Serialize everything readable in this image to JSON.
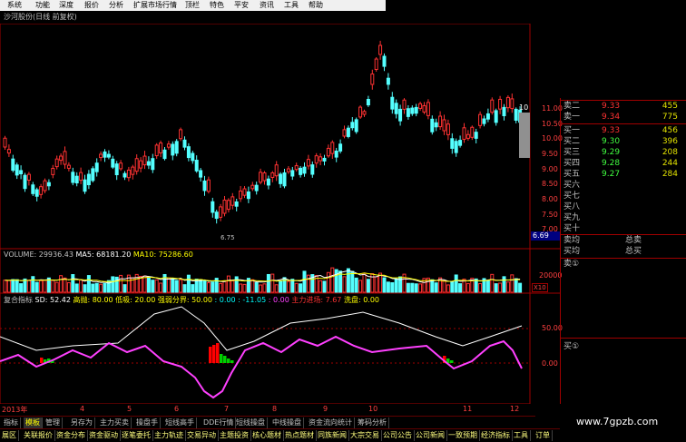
{
  "menu": [
    "系统",
    "功能",
    "深度",
    "报价",
    "分析",
    "扩展市场行情",
    "资讯",
    "工具",
    "帮助"
  ],
  "menu_hidden": [
    "顶栏",
    "特色",
    "平安"
  ],
  "window_title": "沙河股份(日线 前复权)",
  "price_axis": [
    "11.00",
    "10.50",
    "10.00",
    "9.50",
    "9.00",
    "8.50",
    "8.00",
    "7.50",
    "7.00"
  ],
  "last_price_tag": "6.69",
  "price_tag_top": "10",
  "low_marker": "6.75",
  "volume_line": {
    "label": "VOLUME: 29936.43",
    "ma5": "MA5: 68181.20",
    "ma10": "MA10: 75286.60"
  },
  "volume_axis": [
    "20000"
  ],
  "volume_unit": "X10",
  "indicator_line": {
    "name": "复合指标",
    "sd": "SD: 52.42",
    "high": "高抛: 80.00",
    "low": "低吸: 20.00",
    "split": "强弱分界: 50.00",
    "v1": ": 0.00",
    "v2": ": -11.05",
    "v3": ": 0.00",
    "main": "主力进场: 7.67",
    "wash": "洗盘: 0.00"
  },
  "indicator_axis": [
    "50.00",
    "0.00"
  ],
  "x_axis": [
    "2013年",
    "4",
    "5",
    "6",
    "7",
    "8",
    "9",
    "10",
    "11",
    "12"
  ],
  "quote": {
    "sell": [
      {
        "label": "卖二",
        "price": "9.33",
        "vol": "455"
      },
      {
        "label": "卖一",
        "price": "9.34",
        "vol": "775"
      }
    ],
    "buy": [
      {
        "label": "买一",
        "price": "9.33",
        "vol": "456"
      },
      {
        "label": "买二",
        "price": "9.30",
        "vol": "396"
      },
      {
        "label": "买三",
        "price": "9.29",
        "vol": "208"
      },
      {
        "label": "买四",
        "price": "9.28",
        "vol": "244"
      },
      {
        "label": "买五",
        "price": "9.27",
        "vol": "284"
      },
      {
        "label": "买六",
        "price": "",
        "vol": ""
      },
      {
        "label": "买七",
        "price": "",
        "vol": ""
      },
      {
        "label": "买八",
        "price": "",
        "vol": ""
      },
      {
        "label": "买九",
        "price": "",
        "vol": ""
      },
      {
        "label": "买十",
        "price": "",
        "vol": ""
      }
    ],
    "sell_avg": "卖均",
    "buy_avg": "买均",
    "total_sell": "总卖",
    "total_buy": "总买",
    "sell_ring": "卖①",
    "buy_ring": "买①"
  },
  "tabs": [
    "指标",
    "模板",
    "管理",
    "另存为",
    "主力买卖",
    "操盘手",
    "短线高手",
    "DDE行情",
    "短线操盘",
    "中线操盘",
    "资金流向统计",
    "筹码分析"
  ],
  "func_tabs": [
    "展区",
    "关联报价",
    "资金分布",
    "资金驱动",
    "逐笔委托",
    "主力轨迹",
    "交易异动",
    "主题投资",
    "核心题材",
    "热点题材",
    "同族新闻",
    "大宗交易",
    "公司公告",
    "公司新闻",
    "一致预期",
    "经济指标",
    "工具",
    "订单"
  ],
  "watermark": "www.7gpzb.com",
  "colors": {
    "up": "#ff3232",
    "down": "#54ffff",
    "white_line": "#ffffff",
    "yellow_line": "#ffff00",
    "magenta": "#ff40ff",
    "green": "#00d000",
    "grid": "#a00000"
  }
}
